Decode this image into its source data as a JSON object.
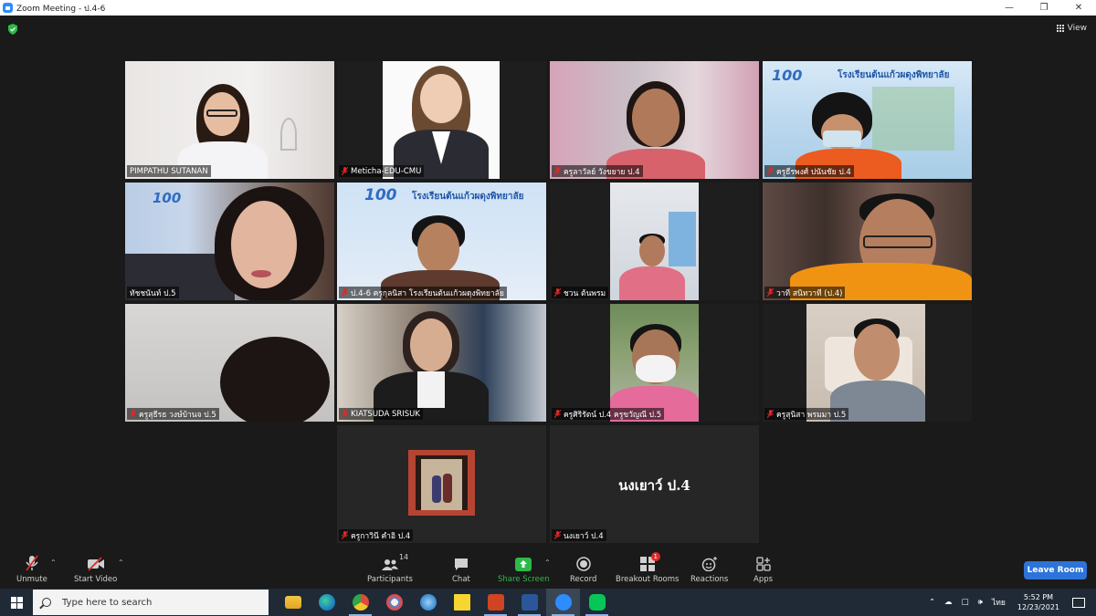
{
  "window": {
    "title": "Zoom Meeting - ป.4-6"
  },
  "header": {
    "view_label": "View"
  },
  "participants": [
    {
      "name": "PIMPATHU SUTANAN",
      "muted": false
    },
    {
      "name": "Meticha-EDU-CMU",
      "muted": true
    },
    {
      "name": "ครูลาวัลย์  วังขยาย ป.4",
      "muted": true
    },
    {
      "name": "ครูธีรพงศ์ ปนันชัย ป.4",
      "muted": true
    },
    {
      "name": "ทัชชนันท์ ป.5",
      "muted": false,
      "active_speaker": true
    },
    {
      "name": "ป.4-6 ครูกุลนิสา โรงเรียนต้นแก้วผดุงพิทยาลัย",
      "muted": true
    },
    {
      "name": "ชวน ต้นพรม",
      "muted": true
    },
    {
      "name": "วาที สนิทวาที (ป.4)",
      "muted": true
    },
    {
      "name": "ครูสุธีรธ วงษ์บ้านจ ป.5",
      "muted": true
    },
    {
      "name": "KIATSUDA SRISUK",
      "muted": true
    },
    {
      "name": "ครูศิริรัตน์  ป.4 ครูขวัญณี ป.5",
      "muted": true
    },
    {
      "name": "ครูสุนิสา พรมมา ป.5",
      "muted": true
    },
    {
      "name": "ครูกาวินี  คำอิ ป.4",
      "muted": true
    },
    {
      "name": "นงเยาว์ ป.4",
      "muted": true,
      "video_off": true
    }
  ],
  "school": {
    "name": "โรงเรียนต้นแก้วผดุงพิทยาลัย",
    "logo_text": "100"
  },
  "toolbar": {
    "unmute": "Unmute",
    "start_video": "Start Video",
    "participants": "Participants",
    "participants_count": "14",
    "chat": "Chat",
    "share_screen": "Share Screen",
    "record": "Record",
    "breakout_rooms": "Breakout Rooms",
    "breakout_badge": "1",
    "reactions": "Reactions",
    "apps": "Apps",
    "leave": "Leave Room"
  },
  "taskbar": {
    "search_placeholder": "Type here to search",
    "language": "ไทย",
    "time": "5:52 PM",
    "date": "12/23/2021"
  },
  "colors": {
    "zoom_blue": "#2d8cff",
    "share_green": "#2fb84a",
    "leave_blue": "#2d73d9",
    "active_speaker": "#d9e87a",
    "mic_off_red": "#e02828"
  }
}
